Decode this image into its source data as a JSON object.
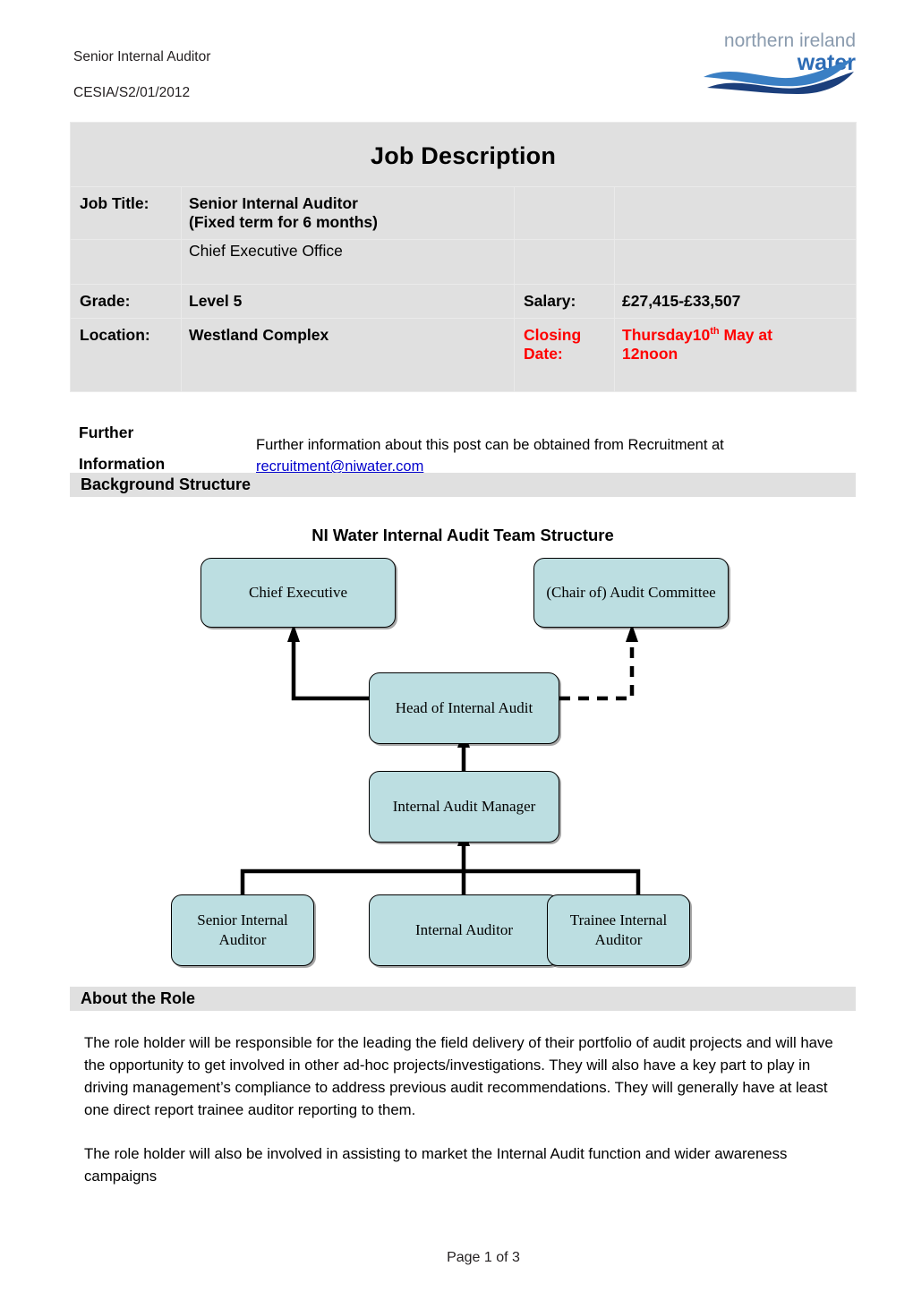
{
  "header": {
    "doc_title": "Senior Internal Auditor",
    "doc_ref": "CESIA/S2/01/2012",
    "logo": {
      "line1": "northern ireland",
      "line2": "water",
      "name": "northern-ireland-water-logo",
      "color_text_top": "#8a9bae",
      "color_text_bottom": "#2d6cb5",
      "color_wave_light": "#3a7fc4",
      "color_wave_dark": "#1b3f7c"
    }
  },
  "job_table": {
    "title": "Job Description",
    "rows": {
      "job_title_label": "Job Title:",
      "job_title_value_bold_1": "Senior Internal Auditor",
      "job_title_value_bold_2": "(Fixed term for 6 months)",
      "job_title_value_regular": "Chief Executive Office",
      "grade_label": "Grade:",
      "grade_value": "Level 5",
      "salary_label": "Salary:",
      "salary_value": "£27,415-£33,507",
      "location_label": "Location:",
      "location_value": "Westland Complex",
      "closing_date_label_line1": "Closing",
      "closing_date_label_line2": "Date:",
      "closing_date_value_line1_a": "Thursday10",
      "closing_date_value_line1_sup": "th",
      "closing_date_value_line1_b": " May at",
      "closing_date_value_line2": "12noon"
    },
    "colors": {
      "cell_background": "#e0e0e0",
      "cell_border": "#eaeaea",
      "highlight_red": "#ff0000"
    }
  },
  "further_information": {
    "label_line1": "Further",
    "label_line2": "Information",
    "text": "Further information about this post can be obtained from Recruitment at",
    "email": "recruitment@niwater.com"
  },
  "sections": {
    "background_structure": "Background Structure",
    "about_the_role": "About the Role"
  },
  "org_chart": {
    "title": "NI Water Internal Audit Team Structure",
    "node_fill": "#bcdee1",
    "node_border": "#000000",
    "nodes": [
      {
        "id": "chief-executive",
        "label": "Chief Executive"
      },
      {
        "id": "audit-committee",
        "label": "(Chair of) Audit Committee"
      },
      {
        "id": "head-of-internal-audit",
        "label": "Head of Internal Audit"
      },
      {
        "id": "internal-audit-manager",
        "label": "Internal Audit Manager"
      },
      {
        "id": "senior-internal-auditor",
        "label": "Senior Internal Auditor"
      },
      {
        "id": "internal-auditor",
        "label": "Internal Auditor"
      },
      {
        "id": "trainee-internal-auditor",
        "label": "Trainee Internal Auditor"
      }
    ],
    "connectors": [
      {
        "from": "head-of-internal-audit",
        "to": "chief-executive",
        "style": "solid"
      },
      {
        "from": "head-of-internal-audit",
        "to": "audit-committee",
        "style": "dashed"
      },
      {
        "from": "internal-audit-manager",
        "to": "head-of-internal-audit",
        "style": "solid"
      },
      {
        "from": "senior-internal-auditor",
        "to": "internal-audit-manager",
        "style": "solid"
      },
      {
        "from": "internal-auditor",
        "to": "internal-audit-manager",
        "style": "solid"
      },
      {
        "from": "trainee-internal-auditor",
        "to": "internal-audit-manager",
        "style": "solid"
      }
    ]
  },
  "about_the_role": {
    "paragraph_1": "The role holder will be responsible for the leading the field delivery of their portfolio of audit projects and will have the opportunity to get involved in other ad-hoc projects/investigations. They will also have a key part to play in driving management’s compliance to address previous audit recommendations.  They will generally have at least one direct report trainee auditor reporting to them.",
    "paragraph_2": "The role holder will also be involved in assisting to market the Internal Audit function and wider awareness campaigns"
  },
  "footer": {
    "page_indicator": "Page 1 of 3"
  }
}
